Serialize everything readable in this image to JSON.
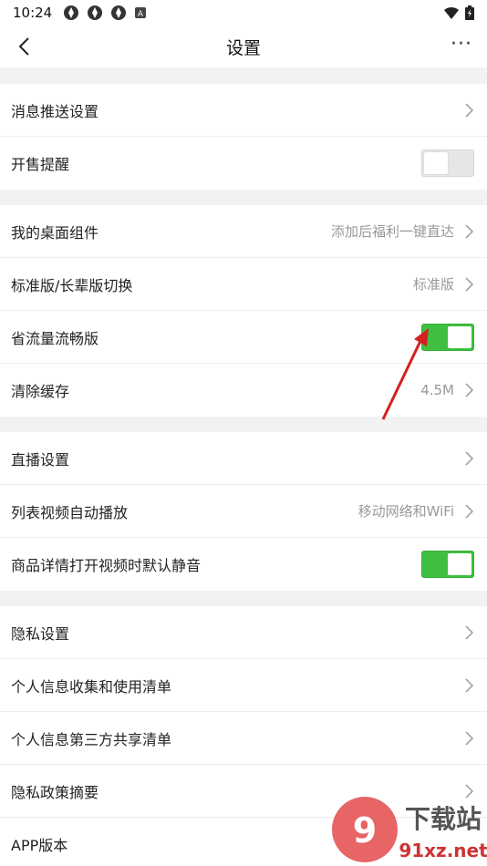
{
  "status_bar": {
    "time": "10:24",
    "icons": [
      "app-badge-icon",
      "app-badge-icon",
      "app-badge-icon",
      "font-a-icon"
    ],
    "right_icons": [
      "wifi-icon",
      "battery-icon"
    ]
  },
  "header": {
    "title": "设置",
    "more_label": "···"
  },
  "sections": [
    {
      "rows": [
        {
          "label": "消息推送设置",
          "value": "",
          "control": "chevron"
        },
        {
          "label": "开售提醒",
          "value": "",
          "control": "toggle",
          "toggle_on": false
        }
      ]
    },
    {
      "rows": [
        {
          "label": "我的桌面组件",
          "value": "添加后福利一键直达",
          "control": "chevron"
        },
        {
          "label": "标准版/长辈版切换",
          "value": "标准版",
          "control": "chevron"
        },
        {
          "label": "省流量流畅版",
          "value": "",
          "control": "toggle",
          "toggle_on": true
        },
        {
          "label": "清除缓存",
          "value": "4.5M",
          "control": "chevron"
        }
      ]
    },
    {
      "rows": [
        {
          "label": "直播设置",
          "value": "",
          "control": "chevron"
        },
        {
          "label": "列表视频自动播放",
          "value": "移动网络和WiFi",
          "control": "chevron"
        },
        {
          "label": "商品详情打开视频时默认静音",
          "value": "",
          "control": "toggle",
          "toggle_on": true
        }
      ]
    },
    {
      "rows": [
        {
          "label": "隐私设置",
          "value": "",
          "control": "chevron"
        },
        {
          "label": "个人信息收集和使用清单",
          "value": "",
          "control": "chevron"
        },
        {
          "label": "个人信息第三方共享清单",
          "value": "",
          "control": "chevron"
        },
        {
          "label": "隐私政策摘要",
          "value": "",
          "control": "chevron"
        },
        {
          "label": "APP版本",
          "value": "",
          "control": "none"
        }
      ]
    }
  ],
  "watermark": {
    "brand": "下载站",
    "site": "91xz.net"
  },
  "colors": {
    "toggle_on": "#3fbf3f",
    "section_gap": "#f2f2f2",
    "annotation_arrow": "#d42020"
  }
}
